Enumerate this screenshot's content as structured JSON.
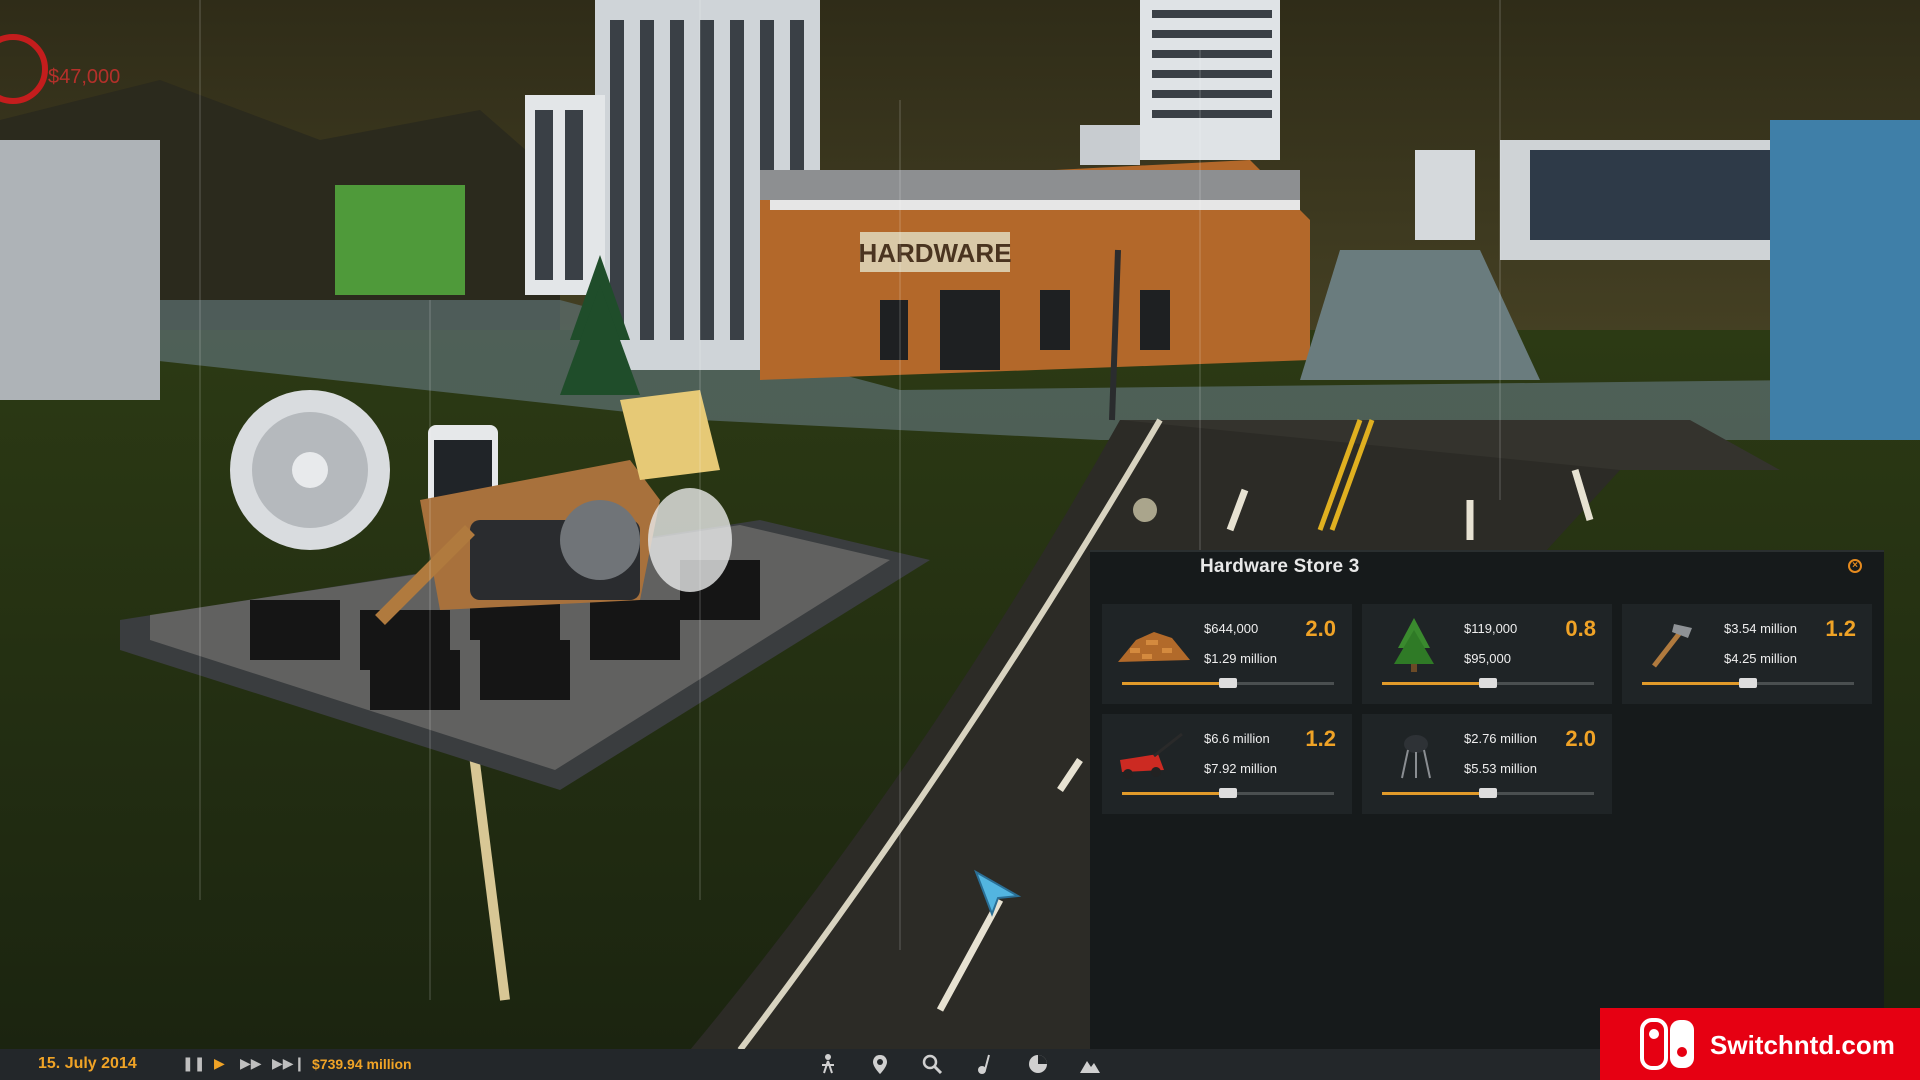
{
  "hud": {
    "floating_cost": "$47,000"
  },
  "scene": {
    "building_sign": "HARDWARE"
  },
  "panel": {
    "title": "Hardware Store 3",
    "close_icon": "close-circle-icon",
    "products": [
      {
        "icon": "wood-chips-icon",
        "price_a": "$644,000",
        "price_b": "$1.29 million",
        "multiplier": "2.0",
        "slider_level": 0.5
      },
      {
        "icon": "tree-sapling-icon",
        "price_a": "$119,000",
        "price_b": "$95,000",
        "multiplier": "0.8",
        "slider_level": 0.5
      },
      {
        "icon": "hammer-icon",
        "price_a": "$3.54 million",
        "price_b": "$4.25 million",
        "multiplier": "1.2",
        "slider_level": 0.5
      },
      {
        "icon": "lawn-mower-icon",
        "price_a": "$6.6 million",
        "price_b": "$7.92 million",
        "multiplier": "1.2",
        "slider_level": 0.5
      },
      {
        "icon": "grill-icon",
        "price_a": "$2.76 million",
        "price_b": "$5.53 million",
        "multiplier": "2.0",
        "slider_level": 0.5
      }
    ]
  },
  "bottombar": {
    "date": "15. July 2014",
    "treasury": "$739.94 million",
    "speed_controls": [
      "pause-icon",
      "play-icon",
      "fast-forward-icon",
      "fastest-forward-icon"
    ],
    "tools": [
      "citizen-icon",
      "map-pin-icon",
      "search-icon",
      "music-note-icon",
      "pie-chart-icon",
      "terrain-icon"
    ]
  },
  "watermark": {
    "text": "Switchntd.com"
  },
  "colors": {
    "accent": "#f0a326",
    "panel_bg": "#161a1b",
    "card_bg": "#1f2426",
    "brand_red": "#e60012"
  }
}
